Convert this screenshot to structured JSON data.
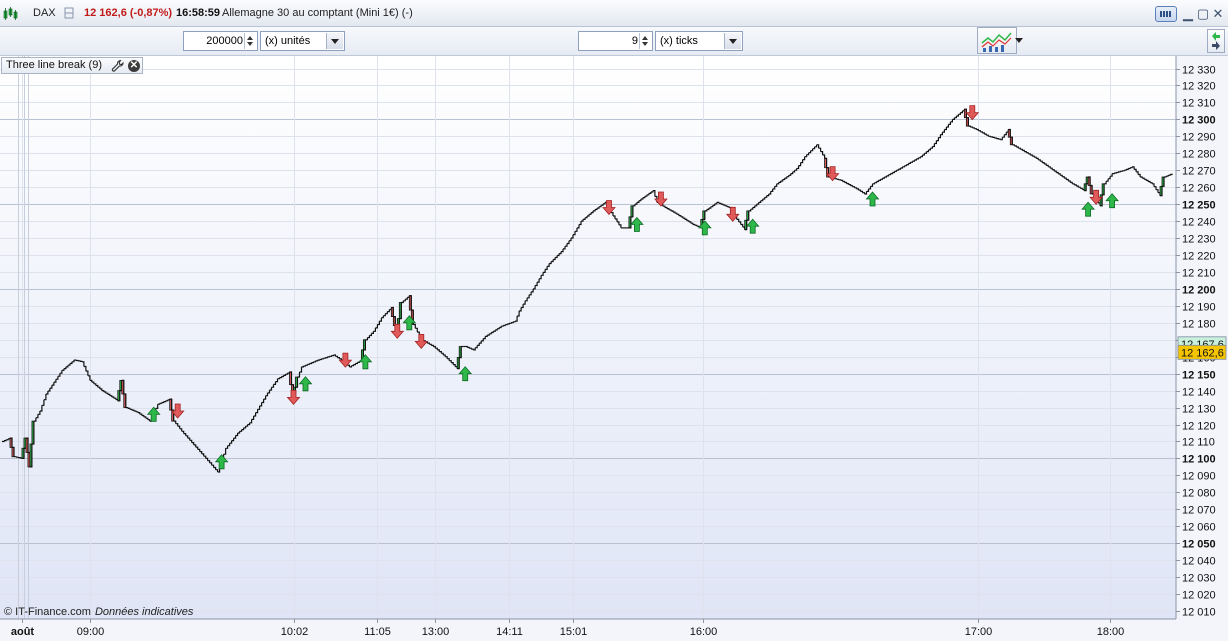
{
  "header": {
    "instrument": "DAX",
    "price_change": "12 162,6 (-0,87%)",
    "time": "16:58:59",
    "description": "Allemagne 30 au comptant (Mini 1€) (-)"
  },
  "toolbar": {
    "units_value": "200000",
    "units_label": "(x) unités",
    "ticks_value": "9",
    "ticks_label": "(x) ticks"
  },
  "indicator_label": "Three line break (9)",
  "credit": {
    "source": "© IT-Finance.com",
    "note": "Données indicatives"
  },
  "colors": {
    "up": "#2fb84a",
    "down": "#e05a5a",
    "line": "#111111",
    "last_price_box": "#f5c400",
    "prev_price_box": "#c8f0dc"
  },
  "chart_data": {
    "type": "line",
    "subtype": "three line break",
    "x_labels": [
      {
        "label": "août",
        "index": 10
      },
      {
        "label": "09:00",
        "index": 44
      },
      {
        "label": "10:02",
        "index": 146
      },
      {
        "label": "11:05",
        "index": 188
      },
      {
        "label": "13:00",
        "index": 217
      },
      {
        "label": "14:11",
        "index": 254
      },
      {
        "label": "15:01",
        "index": 286
      },
      {
        "label": "16:00",
        "index": 351
      },
      {
        "label": "17:00",
        "index": 489
      },
      {
        "label": "18:00",
        "index": 555
      }
    ],
    "x_range": [
      0,
      587
    ],
    "ylim": [
      12005,
      12335
    ],
    "y_ticks": [
      12010,
      12020,
      12030,
      12040,
      12050,
      12060,
      12070,
      12080,
      12090,
      12100,
      12110,
      12120,
      12130,
      12140,
      12150,
      12160,
      12170,
      12180,
      12190,
      12200,
      12210,
      12220,
      12230,
      12240,
      12250,
      12260,
      12270,
      12280,
      12290,
      12300,
      12310,
      12320,
      12330
    ],
    "y_tick_labels": [
      "12 010",
      "12 020",
      "12 030",
      "12 040",
      "12 050",
      "12 060",
      "12 070",
      "12 080",
      "12 090",
      "12 100",
      "12 110",
      "12 120",
      "12 130",
      "12 140",
      "12 150",
      "12 160",
      "12 170",
      "12 180",
      "12 190",
      "12 200",
      "12 210",
      "12 220",
      "12 230",
      "12 240",
      "12 250",
      "12 260",
      "12 270",
      "12 280",
      "12 290",
      "12 300",
      "12 310",
      "12 320",
      "12 330"
    ],
    "y_ticks_major": [
      12050,
      12100,
      12150,
      12200,
      12250,
      12300
    ],
    "price_path": [
      [
        0,
        12110
      ],
      [
        4,
        12112
      ],
      [
        6,
        12101
      ],
      [
        10,
        12100
      ],
      [
        12,
        12112
      ],
      [
        14,
        12095
      ],
      [
        16,
        12122
      ],
      [
        19,
        12128
      ],
      [
        22,
        12138
      ],
      [
        26,
        12145
      ],
      [
        30,
        12152
      ],
      [
        36,
        12158
      ],
      [
        40,
        12157
      ],
      [
        44,
        12146
      ],
      [
        50,
        12140
      ],
      [
        54,
        12137
      ],
      [
        58,
        12134
      ],
      [
        60,
        12146
      ],
      [
        62,
        12130
      ],
      [
        68,
        12127
      ],
      [
        74,
        12122
      ],
      [
        78,
        12132
      ],
      [
        84,
        12135
      ],
      [
        86,
        12122
      ],
      [
        90,
        12116
      ],
      [
        96,
        12108
      ],
      [
        102,
        12100
      ],
      [
        108,
        12092
      ],
      [
        112,
        12106
      ],
      [
        118,
        12115
      ],
      [
        124,
        12121
      ],
      [
        128,
        12129
      ],
      [
        132,
        12137
      ],
      [
        138,
        12147
      ],
      [
        144,
        12151
      ],
      [
        146,
        12136
      ],
      [
        148,
        12148
      ],
      [
        150,
        12154
      ],
      [
        158,
        12158
      ],
      [
        166,
        12161
      ],
      [
        170,
        12158
      ],
      [
        174,
        12154
      ],
      [
        180,
        12158
      ],
      [
        182,
        12170
      ],
      [
        186,
        12175
      ],
      [
        190,
        12183
      ],
      [
        195,
        12189
      ],
      [
        198,
        12173
      ],
      [
        200,
        12192
      ],
      [
        204,
        12196
      ],
      [
        206,
        12179
      ],
      [
        210,
        12170
      ],
      [
        216,
        12166
      ],
      [
        222,
        12160
      ],
      [
        228,
        12153
      ],
      [
        230,
        12166
      ],
      [
        232,
        12166
      ],
      [
        236,
        12164
      ],
      [
        242,
        12172
      ],
      [
        250,
        12178
      ],
      [
        257,
        12181
      ],
      [
        259,
        12187
      ],
      [
        262,
        12193
      ],
      [
        266,
        12200
      ],
      [
        270,
        12208
      ],
      [
        274,
        12215
      ],
      [
        280,
        12222
      ],
      [
        285,
        12230
      ],
      [
        290,
        12240
      ],
      [
        296,
        12246
      ],
      [
        302,
        12251
      ],
      [
        306,
        12243
      ],
      [
        310,
        12236
      ],
      [
        314,
        12236
      ],
      [
        316,
        12249
      ],
      [
        320,
        12253
      ],
      [
        326,
        12258
      ],
      [
        328,
        12251
      ],
      [
        332,
        12248
      ],
      [
        338,
        12244
      ],
      [
        346,
        12238
      ],
      [
        350,
        12236
      ],
      [
        352,
        12246
      ],
      [
        358,
        12251
      ],
      [
        364,
        12248
      ],
      [
        368,
        12241
      ],
      [
        372,
        12235
      ],
      [
        374,
        12246
      ],
      [
        378,
        12250
      ],
      [
        384,
        12256
      ],
      [
        388,
        12262
      ],
      [
        394,
        12267
      ],
      [
        398,
        12271
      ],
      [
        402,
        12278
      ],
      [
        408,
        12285
      ],
      [
        412,
        12277
      ],
      [
        414,
        12266
      ],
      [
        420,
        12264
      ],
      [
        428,
        12259
      ],
      [
        432,
        12256
      ],
      [
        436,
        12262
      ],
      [
        442,
        12266
      ],
      [
        448,
        12270
      ],
      [
        454,
        12274
      ],
      [
        460,
        12278
      ],
      [
        466,
        12284
      ],
      [
        470,
        12291
      ],
      [
        476,
        12300
      ],
      [
        482,
        12306
      ],
      [
        484,
        12296
      ],
      [
        488,
        12294
      ],
      [
        494,
        12290
      ],
      [
        500,
        12288
      ],
      [
        504,
        12294
      ],
      [
        506,
        12285
      ],
      [
        512,
        12281
      ],
      [
        518,
        12277
      ],
      [
        524,
        12272
      ],
      [
        530,
        12267
      ],
      [
        536,
        12262
      ],
      [
        542,
        12258
      ],
      [
        544,
        12266
      ],
      [
        546,
        12256
      ],
      [
        550,
        12249
      ],
      [
        552,
        12262
      ],
      [
        556,
        12268
      ],
      [
        562,
        12270
      ],
      [
        566,
        12272
      ],
      [
        570,
        12266
      ],
      [
        576,
        12262
      ],
      [
        580,
        12255
      ],
      [
        582,
        12266
      ],
      [
        586,
        12268
      ]
    ],
    "buy_signals": [
      [
        76,
        12126
      ],
      [
        110,
        12098
      ],
      [
        152,
        12144
      ],
      [
        182,
        12157
      ],
      [
        204,
        12180
      ],
      [
        232,
        12150
      ],
      [
        318,
        12238
      ],
      [
        352,
        12236
      ],
      [
        376,
        12237
      ],
      [
        436,
        12253
      ],
      [
        544,
        12247
      ],
      [
        556,
        12252
      ]
    ],
    "sell_signals": [
      [
        88,
        12128
      ],
      [
        146,
        12136
      ],
      [
        172,
        12158
      ],
      [
        198,
        12175
      ],
      [
        210,
        12169
      ],
      [
        304,
        12248
      ],
      [
        330,
        12253
      ],
      [
        366,
        12244
      ],
      [
        416,
        12268
      ],
      [
        486,
        12304
      ],
      [
        548,
        12254
      ]
    ],
    "current_price": 12162.6,
    "current_price_label": "12 162,6",
    "prev_close": 12167.6,
    "prev_close_label": "12 167,6",
    "grid": true
  }
}
